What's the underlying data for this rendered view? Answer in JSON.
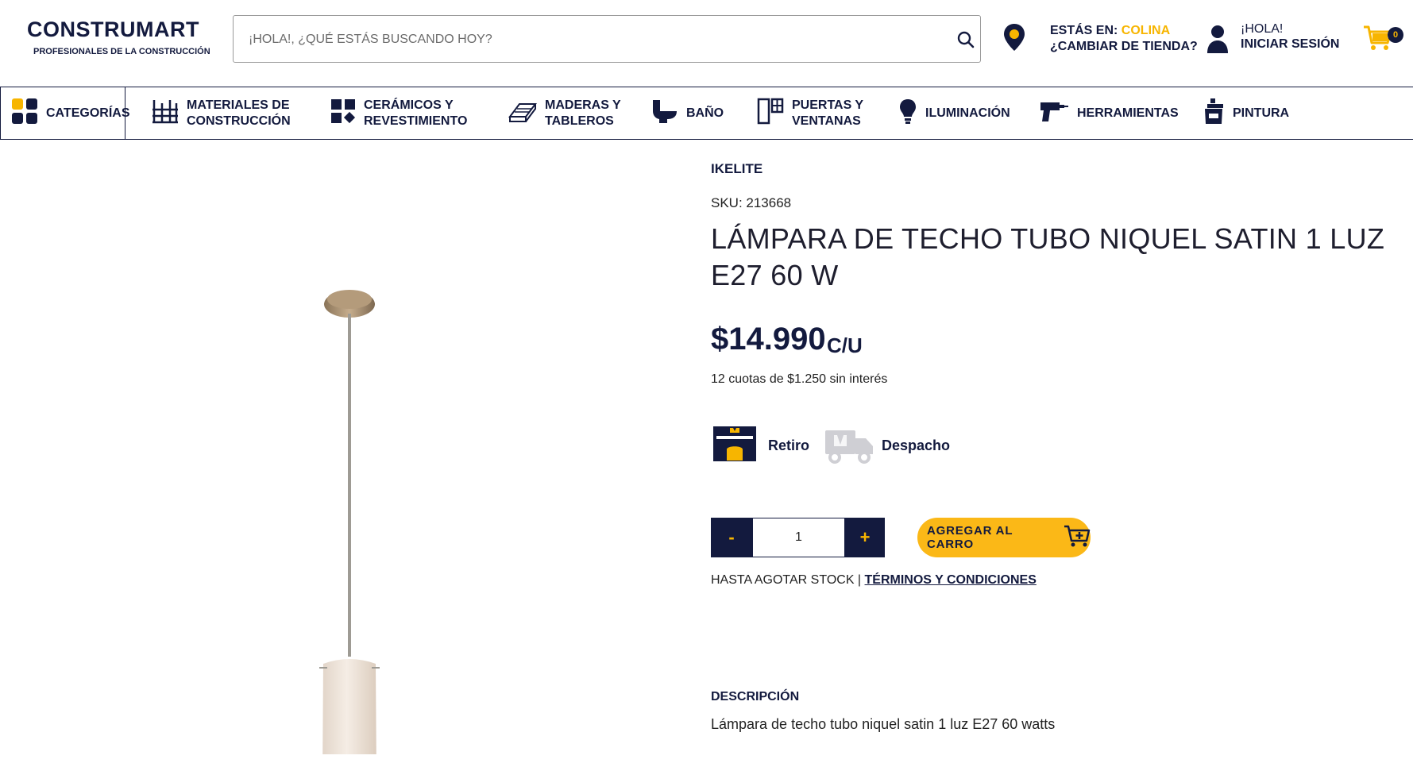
{
  "header": {
    "logo_main": "CONSTRUMART",
    "logo_sub": "PROFESIONALES DE LA CONSTRUCCIÓN",
    "search_placeholder": "¡HOLA!, ¿QUÉ ESTÁS BUSCANDO HOY?",
    "store_prefix": "ESTÁS EN: ",
    "store_name": "COLINA",
    "change_store": "¿CAMBIAR DE TIENDA?",
    "greeting": "¡HOLA!",
    "login": "INICIAR SESIÓN",
    "cart_count": "0"
  },
  "nav": {
    "categories": "CATEGORÍAS",
    "items": [
      {
        "line1": "MATERIALES DE",
        "line2": "CONSTRUCCIÓN"
      },
      {
        "line1": "CERÁMICOS Y",
        "line2": "REVESTIMIENTO"
      },
      {
        "line1": "MADERAS Y",
        "line2": "TABLEROS"
      },
      {
        "line1": "BAÑO",
        "line2": ""
      },
      {
        "line1": "PUERTAS Y",
        "line2": "VENTANAS"
      },
      {
        "line1": "ILUMINACIÓN",
        "line2": ""
      },
      {
        "line1": "HERRAMIENTAS",
        "line2": ""
      },
      {
        "line1": "PINTURA",
        "line2": ""
      }
    ]
  },
  "product": {
    "brand": "IKELITE",
    "sku": "SKU: 213668",
    "title": "LÁMPARA DE TECHO TUBO NIQUEL SATIN 1 LUZ E27 60 W",
    "price": "$14.990",
    "price_unit": "C/U",
    "installments": "12 cuotas de $1.250 sin interés",
    "pickup_label": "Retiro",
    "delivery_label": "Despacho",
    "qty_minus": "-",
    "qty_value": "1",
    "qty_plus": "+",
    "add_to_cart": "AGREGAR AL CARRO",
    "stock_text": "HASTA AGOTAR STOCK | ",
    "terms_link": "TÉRMINOS Y CONDICIONES",
    "description_heading": "DESCRIPCIÓN",
    "description": "Lámpara de techo tubo niquel satin 1 luz E27 60 watts"
  },
  "colors": {
    "navy": "#131a3e",
    "yellow": "#f7b500"
  }
}
